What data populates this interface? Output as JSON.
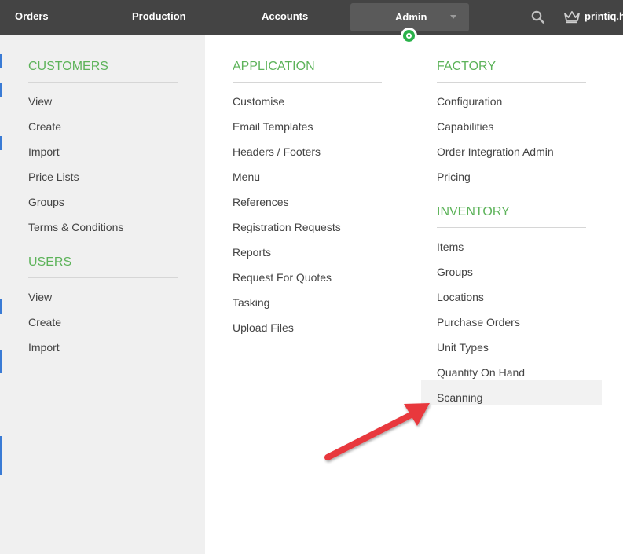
{
  "topnav": {
    "items": [
      {
        "label": "Orders"
      },
      {
        "label": "Production"
      },
      {
        "label": "Accounts"
      },
      {
        "label": "Admin"
      }
    ],
    "tenant": "printiq.hc"
  },
  "colors": {
    "topbar": "#444444",
    "accent_green": "#5db35a",
    "arrow_red": "#e8383d"
  },
  "icons": [
    "search-icon",
    "crown-icon",
    "chevron-down-icon",
    "active-indicator-icon"
  ],
  "menu": {
    "customers": {
      "title": "CUSTOMERS",
      "items": [
        "View",
        "Create",
        "Import",
        "Price Lists",
        "Groups",
        "Terms & Conditions"
      ]
    },
    "users": {
      "title": "USERS",
      "items": [
        "View",
        "Create",
        "Import"
      ]
    },
    "application": {
      "title": "APPLICATION",
      "items": [
        "Customise",
        "Email Templates",
        "Headers / Footers",
        "Menu",
        "References",
        "Registration Requests",
        "Reports",
        "Request For Quotes",
        "Tasking",
        "Upload Files"
      ]
    },
    "factory": {
      "title": "FACTORY",
      "items": [
        "Configuration",
        "Capabilities",
        "Order Integration Admin",
        "Pricing"
      ]
    },
    "inventory": {
      "title": "INVENTORY",
      "items": [
        "Items",
        "Groups",
        "Locations",
        "Purchase Orders",
        "Unit Types",
        "Quantity On Hand",
        "Scanning"
      ],
      "hovered": "Scanning"
    }
  }
}
